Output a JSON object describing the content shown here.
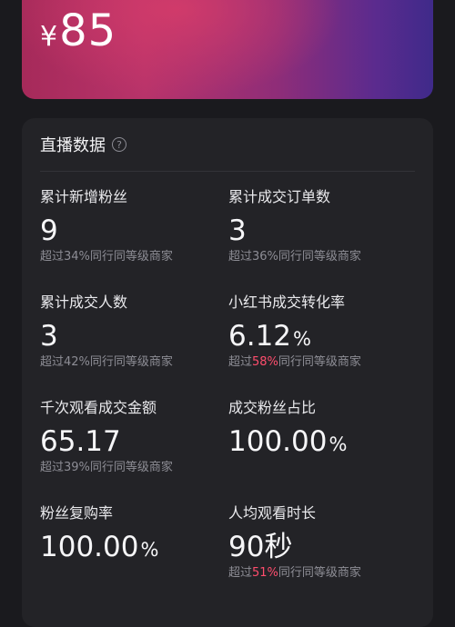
{
  "hero": {
    "currency": "¥",
    "amount": "85"
  },
  "section": {
    "title": "直播数据",
    "help_symbol": "?"
  },
  "metrics": {
    "fans": {
      "label": "累计新增粉丝",
      "value": "9",
      "compare_prefix": "超过",
      "compare_pct": "34%",
      "compare_suffix": "同行同等级商家",
      "compare_highlight": false
    },
    "orders": {
      "label": "累计成交订单数",
      "value": "3",
      "compare_prefix": "超过",
      "compare_pct": "36%",
      "compare_suffix": "同行同等级商家",
      "compare_highlight": false
    },
    "buyers": {
      "label": "累计成交人数",
      "value": "3",
      "compare_prefix": "超过",
      "compare_pct": "42%",
      "compare_suffix": "同行同等级商家",
      "compare_highlight": false
    },
    "conversion": {
      "label": "小红书成交转化率",
      "value": "6.12",
      "unit": "%",
      "compare_prefix": "超过",
      "compare_pct": "58%",
      "compare_suffix": "同行同等级商家",
      "compare_highlight": true
    },
    "gmv_per_k": {
      "label": "千次观看成交金额",
      "value": "65.17",
      "compare_prefix": "超过",
      "compare_pct": "39%",
      "compare_suffix": "同行同等级商家",
      "compare_highlight": false
    },
    "fan_ratio": {
      "label": "成交粉丝占比",
      "value": "100.00",
      "unit": "%"
    },
    "repurchase": {
      "label": "粉丝复购率",
      "value": "100.00",
      "unit": "%"
    },
    "watch_time": {
      "label": "人均观看时长",
      "value": "90秒",
      "compare_prefix": "超过",
      "compare_pct": "51%",
      "compare_suffix": "同行同等级商家",
      "compare_highlight": true
    }
  },
  "colors": {
    "highlight": "#ff4d6d",
    "card_bg": "#232327",
    "page_bg": "#1a1a1e"
  }
}
